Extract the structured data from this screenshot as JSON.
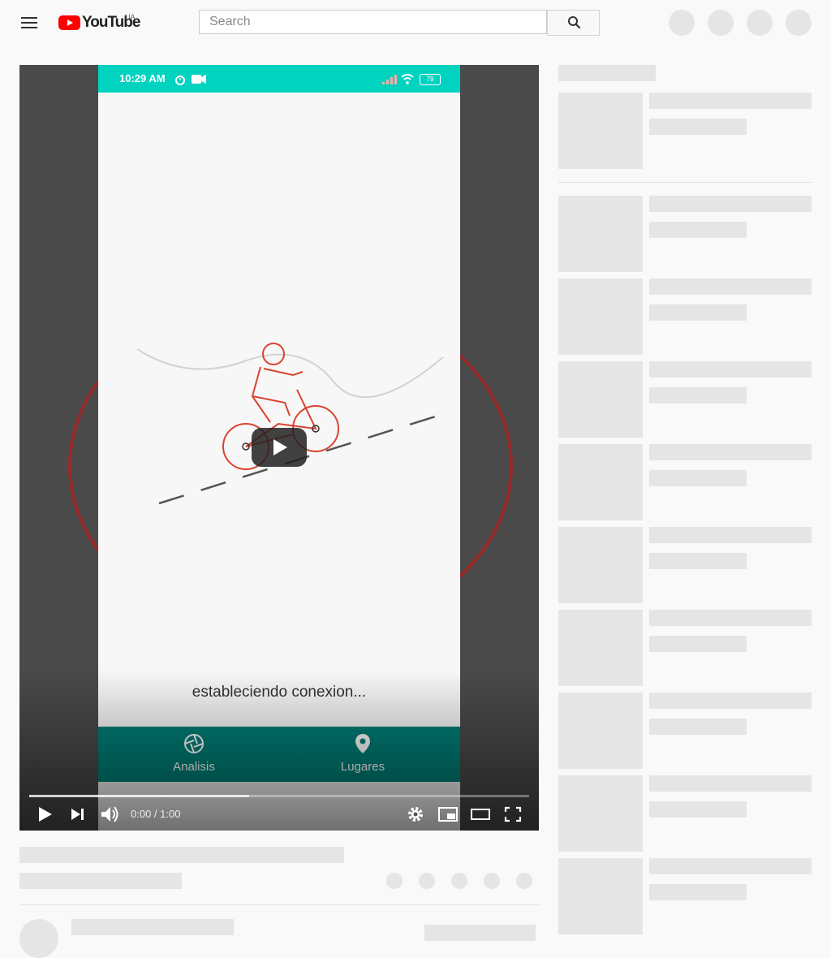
{
  "app": {
    "logo_text": "YouTube",
    "country_code": "UA"
  },
  "search": {
    "placeholder": "Search"
  },
  "header": {
    "menu_icon": "hamburger-menu-icon",
    "search_icon": "magnifier-icon",
    "placeholders": [
      "avatar-placeholder",
      "avatar-placeholder",
      "avatar-placeholder",
      "avatar-placeholder"
    ]
  },
  "video_frame": {
    "status_time": "10:29 AM",
    "battery": "79",
    "loading_text": "estableciendo conexion...",
    "bottom_nav": [
      {
        "label": "Analisis",
        "icon": "camera-shutter-icon"
      },
      {
        "label": "Lugares",
        "icon": "map-pin-icon"
      }
    ],
    "accent_color": "#00d3bf",
    "nav_color": "#007f77",
    "illustration_color": "#d9432f"
  },
  "player": {
    "current_time": "0:00",
    "duration": "1:00",
    "time_display": "0:00 / 1:00",
    "buffered_fraction": 0.44,
    "controls": [
      "play-icon",
      "next-icon",
      "volume-icon",
      "settings-icon",
      "miniplayer-icon",
      "theater-mode-icon",
      "fullscreen-icon"
    ]
  },
  "sidebar": {
    "skeleton_item_count": 10
  }
}
